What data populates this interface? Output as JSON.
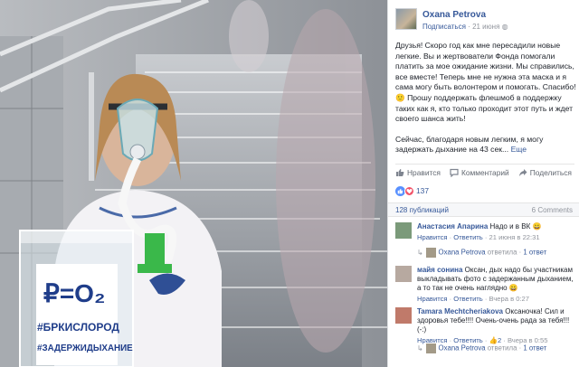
{
  "photo": {
    "sign_line1": "₽=O₂",
    "sign_line2": "#БРКИСЛОРОД",
    "sign_line3": "#ЗАДЕРЖИДЫХАНИЕ"
  },
  "post": {
    "author": "Oxana Petrova",
    "follow_label": "Подписаться",
    "date": "21 июня",
    "paragraph1": "Друзья! Скоро год как мне пересадили новые легкие. Вы и жертвователи Фонда помогали платить за мое ожидание жизни. Мы справились, все вместе! Теперь мне не нужна эта маска и я сама могу быть волонтером и помогать. Спасибо! 🙂 Прошу поддержать флешмоб в поддержку таких как я, кто только проходит этот путь и ждет своего шанса жить!",
    "paragraph2": "Сейчас, благодаря новым легким, я могу задержать дыхание на 43 сек...",
    "more_label": "Еще"
  },
  "actions": {
    "like": "Нравится",
    "comment": "Комментарий",
    "share": "Поделиться"
  },
  "reactions": {
    "count": "137"
  },
  "comments_bar": {
    "publications": "128 публикаций",
    "comments_count": "6 Comments"
  },
  "comments": [
    {
      "author": "Анастасия Апарина",
      "text": "Надо и в ВК 😀",
      "like": "Нравится",
      "reply": "Ответить",
      "time": "21 июня в 22:31",
      "reply_author": "Oxana Petrova",
      "reply_verb": "ответила",
      "reply_count": "1 ответ"
    },
    {
      "author": "майя сонина",
      "text": "Оксан, дых надо бы участникам выкладывать фото с задержанным дыханием, а то так не очень наглядно 😀",
      "like": "Нравится",
      "reply": "Ответить",
      "time": "Вчера в 0:27"
    },
    {
      "author": "Tamara Mechtcheriakova",
      "text": "Оксаночка! Сил и здоровья тебе!!!! Очень-очень рада за тебя!!!(-:)",
      "like": "Нравится",
      "reply": "Ответить",
      "likes": "2",
      "time": "Вчера в 0:55",
      "reply_author": "Oxana Petrova",
      "reply_verb": "ответила",
      "reply_count": "1 ответ"
    }
  ],
  "colors": {
    "link": "#365899",
    "muted": "#90949c",
    "sign_blue": "#1f3d8a",
    "like_blue": "#5890ff",
    "love_red": "#f25268"
  }
}
